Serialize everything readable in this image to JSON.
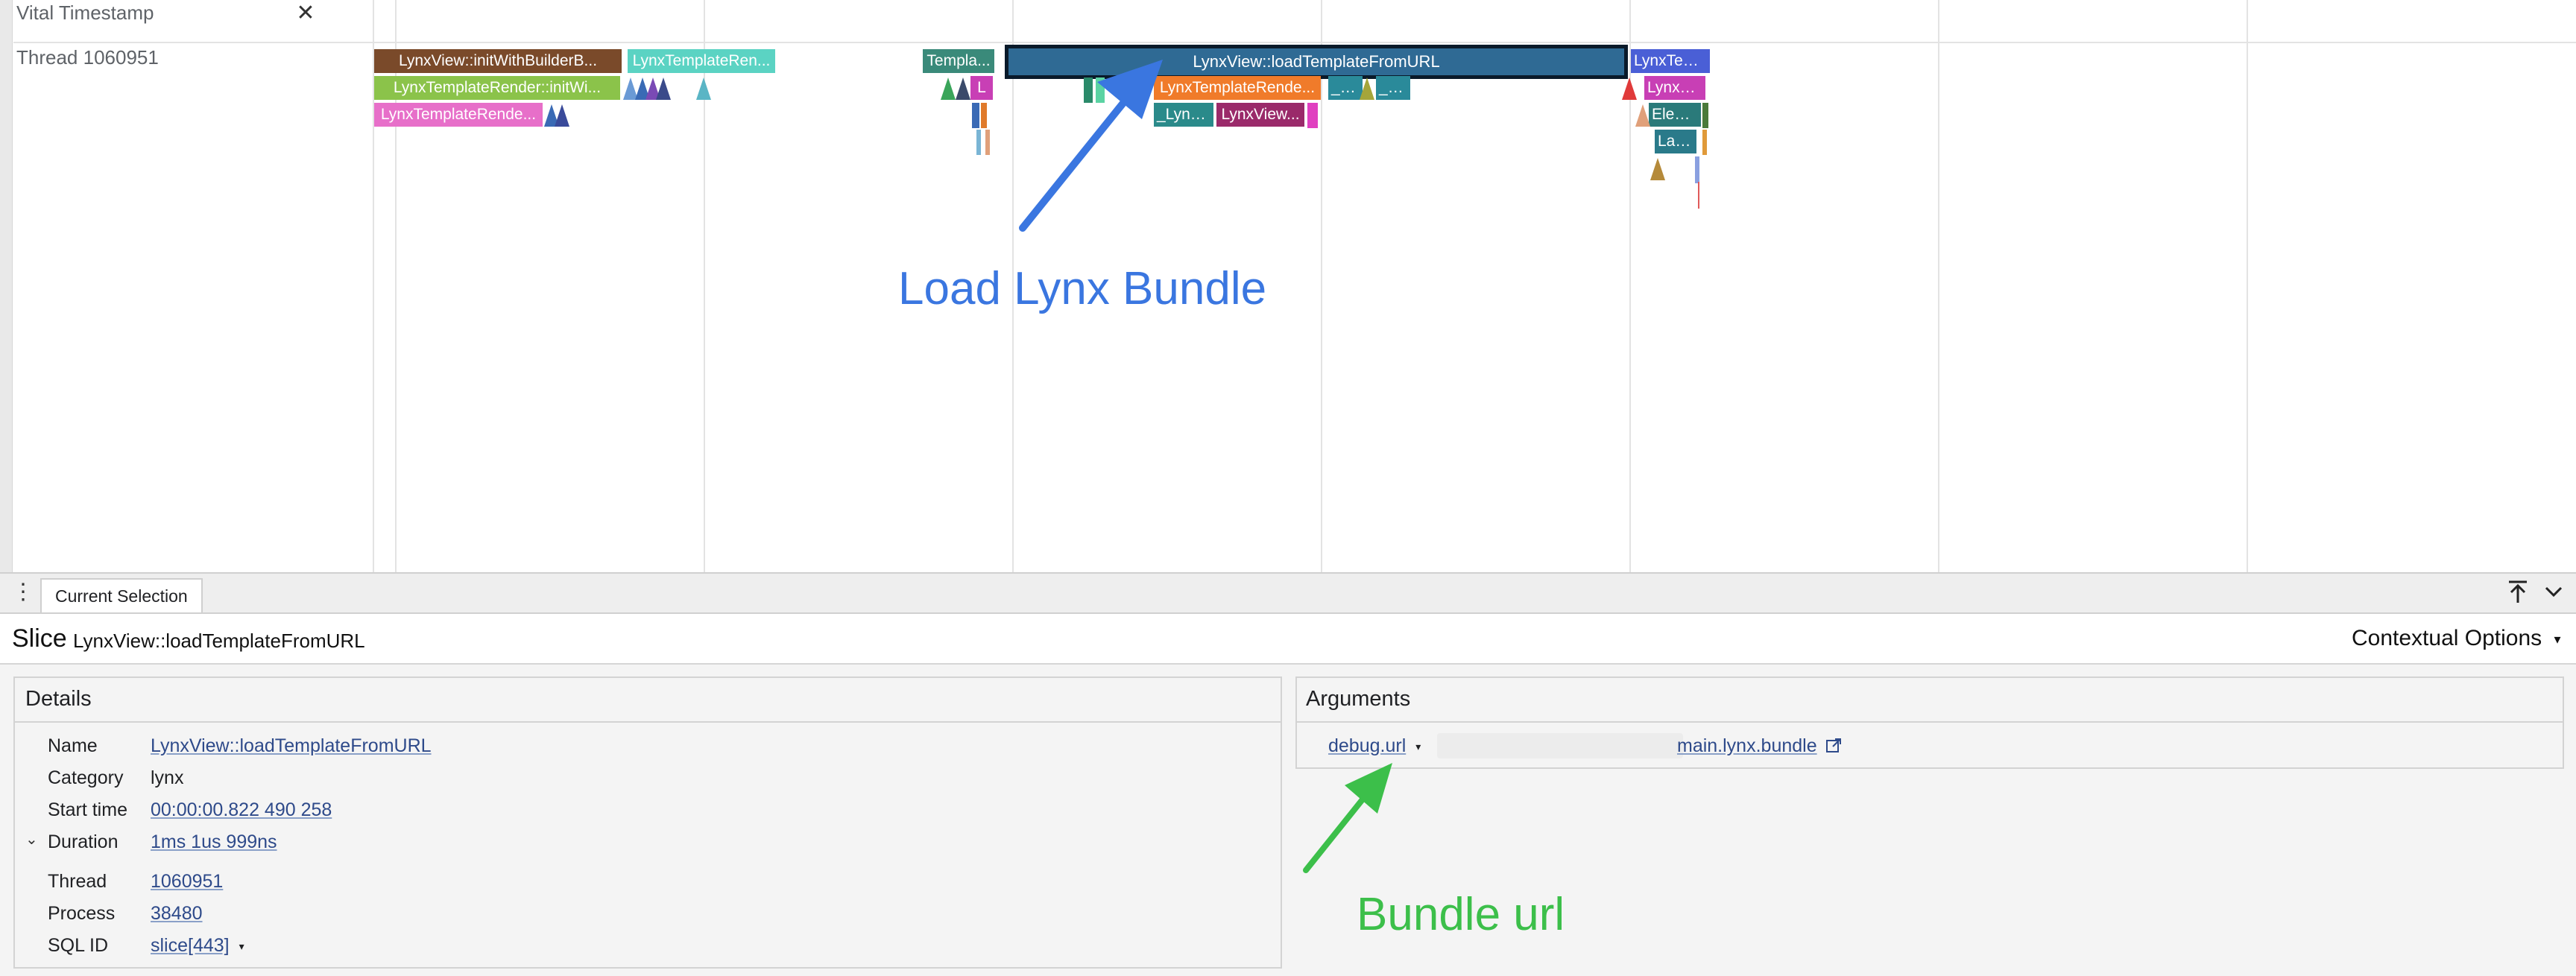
{
  "timeline": {
    "tracks": {
      "vital_label": "Vital Timestamp",
      "thread_label": "Thread 1060951"
    },
    "slices": [
      {
        "label": "LynxView::initWithBuilderB...",
        "color": "#7a4a2a"
      },
      {
        "label": "LynxTemplateRen...",
        "color": "#5bd3c3"
      },
      {
        "label": "LynxTemplateRender::initWi...",
        "color": "#8bc34a"
      },
      {
        "label": "LynxTemplateRende...",
        "color": "#e76fc9"
      },
      {
        "label": "Templa...",
        "color": "#3a8a7a"
      },
      {
        "label": "L",
        "color": "#c83fb5"
      },
      {
        "label": "LynxView::loadTemplateFromURL",
        "color": "#2f6a94"
      },
      {
        "label": "LynxTemplateRende...",
        "color": "#f07b2a"
      },
      {
        "label": "_Lynx...",
        "color": "#2a8a8a"
      },
      {
        "label": "LynxView...",
        "color": "#9a2a6a"
      },
      {
        "label": "_L...",
        "color": "#2a8a9a"
      },
      {
        "label": "_L...",
        "color": "#2a8a9a"
      },
      {
        "label": "LynxTem...",
        "color": "#4a5fd6"
      },
      {
        "label": "LynxE...",
        "color": "#c83fb5"
      },
      {
        "label": "Elem...",
        "color": "#2a7a7a"
      },
      {
        "label": "Lay...",
        "color": "#2a7a8a"
      }
    ],
    "annotations": {
      "load_bundle": "Load Lynx Bundle",
      "bundle_url": "Bundle url",
      "load_color": "#3a76e0",
      "bundle_color": "#3cbf4a"
    }
  },
  "panel": {
    "tab_label": "Current Selection",
    "slice_word": "Slice",
    "slice_name": "LynxView::loadTemplateFromURL",
    "contextual_options": "Contextual Options",
    "details": {
      "title": "Details",
      "rows": {
        "name_key": "Name",
        "name_val": "LynxView::loadTemplateFromURL",
        "category_key": "Category",
        "category_val": "lynx",
        "start_key": "Start time",
        "start_val": "00:00:00.822 490 258",
        "duration_key": "Duration",
        "duration_val": "1ms 1us 999ns",
        "thread_key": "Thread",
        "thread_val": "1060951",
        "process_key": "Process",
        "process_val": "38480",
        "sqlid_key": "SQL ID",
        "sqlid_val": "slice[443]"
      }
    },
    "arguments": {
      "title": "Arguments",
      "key": "debug.url",
      "value_suffix": "main.lynx.bundle"
    }
  }
}
